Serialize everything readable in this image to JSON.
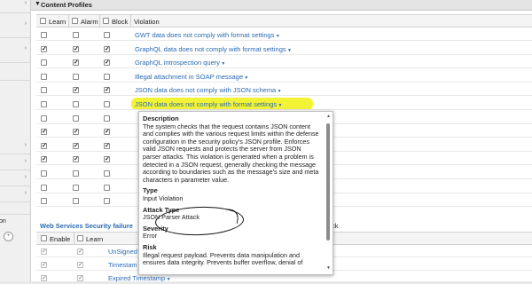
{
  "section": {
    "title": "Content Profiles",
    "collapse_icon": "triangle-down-icon"
  },
  "columns": {
    "learn": "Learn",
    "alarm": "Alarm",
    "block": "Block",
    "violation": "Violation"
  },
  "violations": [
    {
      "learn": false,
      "alarm": false,
      "block": false,
      "name": "GWT data does not comply with format settings"
    },
    {
      "learn": true,
      "alarm": true,
      "block": true,
      "name": "GraphQL data does not comply with format settings"
    },
    {
      "learn": false,
      "alarm": true,
      "block": true,
      "name": "GraphQL introspection query"
    },
    {
      "learn": false,
      "alarm": false,
      "block": false,
      "name": "Illegal attachment in SOAP message"
    },
    {
      "learn": false,
      "alarm": true,
      "block": true,
      "name": "JSON data does not comply with JSON schema"
    },
    {
      "learn": false,
      "alarm": false,
      "block": false,
      "name": "JSON data does not comply with format settings"
    },
    {
      "learn": false,
      "alarm": false,
      "block": false,
      "name": ""
    },
    {
      "learn": true,
      "alarm": true,
      "block": true,
      "name": ""
    },
    {
      "learn": true,
      "alarm": true,
      "block": true,
      "name": ""
    },
    {
      "learn": true,
      "alarm": true,
      "block": true,
      "name": ""
    },
    {
      "learn": false,
      "alarm": false,
      "block": false,
      "name": ""
    },
    {
      "learn": false,
      "alarm": false,
      "block": false,
      "name": ""
    },
    {
      "learn": false,
      "alarm": false,
      "block": false,
      "name": ""
    }
  ],
  "popup": {
    "description_label": "Description",
    "description": "The system checks that the request contains JSON content and complies with the various request limits within the defense configuration in the security policy's JSON profile. Enforces valid JSON requests and protects the server from JSON parser attacks. This violation is generated when a problem is detected in a JSON request, generally checking the message according to boundaries such as the message's size and meta characters in parameter value.",
    "type_label": "Type",
    "type": "Input Violation",
    "attack_type_label": "Attack Type",
    "attack_type": "JSON Parser Attack",
    "severity_label": "Severity",
    "severity": "Error",
    "risk_label": "Risk",
    "risk": "Illegal request payload. Prevents data manipulation and ensures data integrity. Prevents buffer overflow, denial of"
  },
  "ws": {
    "title": "Web Services Security failure",
    "columns": {
      "enable": "Enable",
      "learn": "Learn"
    },
    "rows": [
      {
        "enable": true,
        "learn": true,
        "name": "UnSigned"
      },
      {
        "enable": true,
        "learn": true,
        "name": "Timestam"
      },
      {
        "enable": true,
        "learn": true,
        "name": "Expired Timestamp"
      }
    ],
    "right_fragment": "ck"
  },
  "left_fragment": "on"
}
